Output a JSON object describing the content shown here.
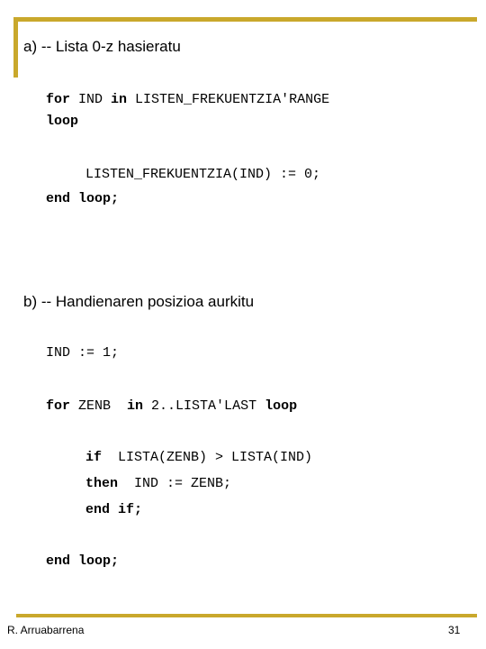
{
  "slide": {
    "accent_color": "#C9A82C",
    "background_color": "#ffffff",
    "text_color": "#000000"
  },
  "headings": {
    "a": "a) -- Lista 0-z hasieratu",
    "b": "b) -- Handienaren posizioa aurkitu"
  },
  "code": {
    "line1_kw1": "for",
    "line1_id1": " IND ",
    "line1_kw2": "in",
    "line1_id2": " LISTEN_FREKUENTZIA'RANGE",
    "line2_kw": "loop",
    "line3": "LISTEN_FREKUENTZIA(IND) := 0;",
    "line4": "end loop;",
    "line5": "IND := 1;",
    "line6_kw1": "for",
    "line6_id1": " ZENB  ",
    "line6_kw2": "in",
    "line6_id2": " 2..LISTA'LAST ",
    "line6_kw3": "loop",
    "line7_kw": "if",
    "line7_expr": "  LISTA(ZENB) > LISTA(IND)",
    "line8_kw": "then",
    "line8_expr": "  IND := ZENB;",
    "line9": "end if;",
    "line10": "end loop;"
  },
  "footer": {
    "author": "R. Arruabarrena",
    "page_number": "31"
  }
}
